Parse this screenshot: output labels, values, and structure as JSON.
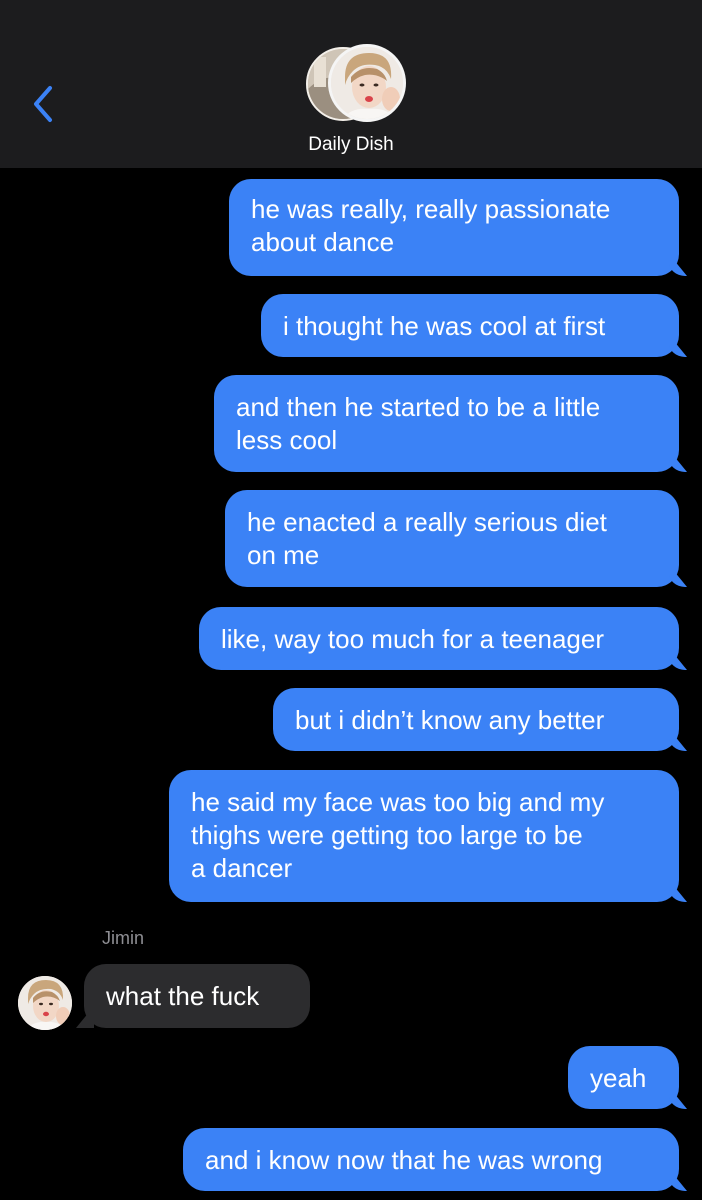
{
  "header": {
    "title": "Daily Dish",
    "back_icon": "chevron-left-icon",
    "accent_color": "#3b82f6"
  },
  "thread": {
    "messages": [
      {
        "direction": "out",
        "text": "he was really, really passionate\nabout dance"
      },
      {
        "direction": "out",
        "text": "i thought he was cool at first"
      },
      {
        "direction": "out",
        "text": "and then he started to be a little\nless cool"
      },
      {
        "direction": "out",
        "text": "he enacted a really serious diet\non me"
      },
      {
        "direction": "out",
        "text": "like, way too much for a teenager"
      },
      {
        "direction": "out",
        "text": "but i didn’t know any better"
      },
      {
        "direction": "out",
        "text": "he said my face was too big and my\nthighs were getting too large to be\na dancer"
      },
      {
        "direction": "in",
        "sender": "Jimin",
        "text": "what the fuck"
      },
      {
        "direction": "out",
        "text": "yeah"
      },
      {
        "direction": "out",
        "text": "and i know now that he was wrong"
      }
    ]
  },
  "colors": {
    "outgoing_bubble": "#3b82f6",
    "incoming_bubble": "#2c2c2e",
    "background": "#000000",
    "header_background": "#1c1c1e"
  }
}
